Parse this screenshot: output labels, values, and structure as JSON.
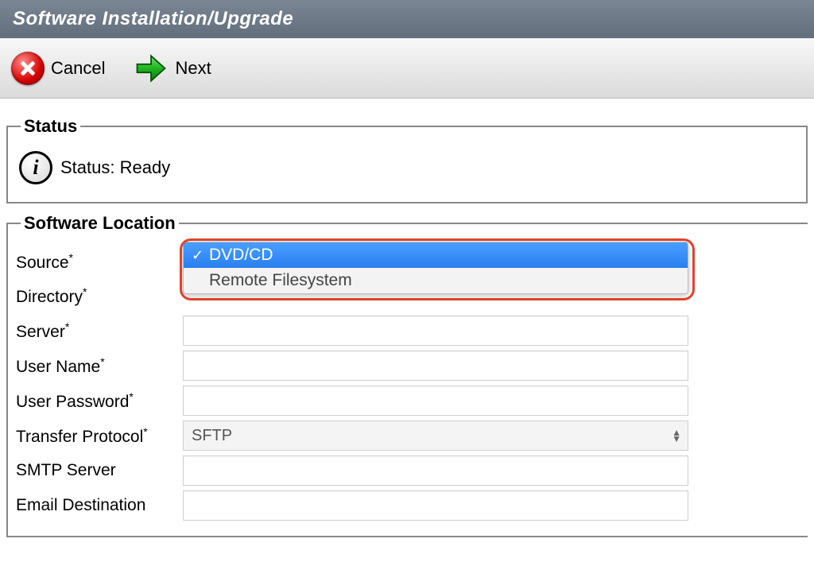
{
  "header": {
    "title": "Software Installation/Upgrade"
  },
  "toolbar": {
    "cancel_label": "Cancel",
    "next_label": "Next"
  },
  "status": {
    "legend": "Status",
    "text": "Status: Ready"
  },
  "location": {
    "legend": "Software Location",
    "labels": {
      "source": "Source",
      "directory": "Directory",
      "server": "Server",
      "user_name": "User Name",
      "user_password": "User Password",
      "transfer_protocol": "Transfer Protocol",
      "smtp_server": "SMTP Server",
      "email_destination": "Email Destination"
    },
    "values": {
      "directory": "",
      "server": "",
      "user_name": "",
      "user_password": "",
      "smtp_server": "",
      "email_destination": ""
    },
    "source_dropdown": {
      "selected": "DVD/CD",
      "options": [
        "DVD/CD",
        "Remote Filesystem"
      ]
    },
    "transfer_protocol": {
      "selected": "SFTP"
    },
    "required_marker": "*"
  }
}
